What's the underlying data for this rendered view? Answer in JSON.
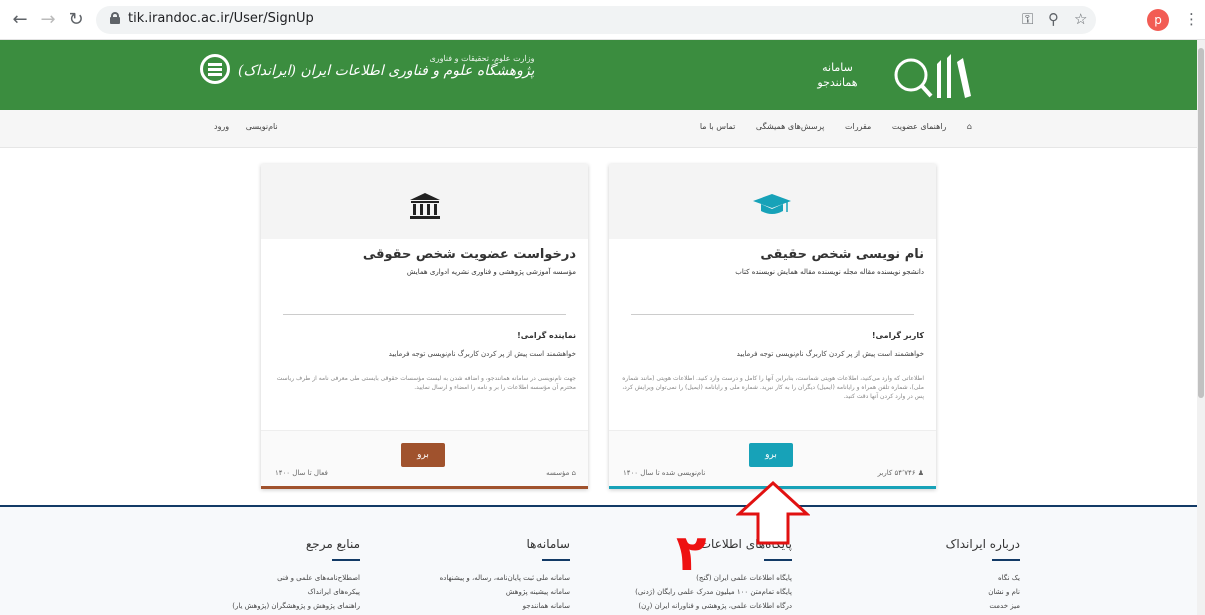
{
  "browser": {
    "url": "tik.irandoc.ac.ir/User/SignUp",
    "profile_initial": "p"
  },
  "header": {
    "brand_right_line1": "سامانه",
    "brand_right_line2": "همانندجو",
    "brand_left_small": "وزارت علوم، تحقیقات و فناوری",
    "brand_left_big": "پژوهشگاه علوم و فناوری اطلاعات ایران (ایرانداک)",
    "bg_color": "#3b8d3f"
  },
  "nav": {
    "items": [
      "راهنمای عضویت",
      "مقررات",
      "پرسش‌های همیشگی",
      "تماس با ما"
    ],
    "signup_label": "نام‌نویسی",
    "login_label": "ورود"
  },
  "cards": {
    "natural": {
      "title": "نام نویسی شخص حقیقی",
      "subtitle": "دانشجو  نویسنده مقاله مجله  نویسنده مقاله همایش  نویسنده کتاب",
      "greeting": "کاربر گرامی!",
      "note": "خواهشمند است پیش از پر کردن کاربرگ نام‌نویسی توجه فرمایید",
      "desc": "اطلاعاتی که وارد می‌کنید، اطلاعات هویتی شماست، بنابراین آنها را کامل و درست وارد کنید. اطلاعات هویتی (مانند شماره ملی)، شماره تلفن همراه و رایانامه (ایمیل) دیگران را به کار نبرید. شماره ملی و رایانامه (ایمیل) را نمی‌توان ویرایش کرد، پس در وارد کردن آنها دقت کنید.",
      "button": "برو",
      "users": "۵۴٬۷۴۶ کاربر",
      "status": "نام‌نویسی شده تا سال ۱۴۰۰",
      "accent": "#17a2b8"
    },
    "legal": {
      "title": "درخواست عضویت شخص حقوقی",
      "subtitle": "مؤسسه آموزشی پژوهشی و فناوری  نشریه ادواری  همایش",
      "greeting": "نماینده گرامی!",
      "note": "خواهشمند است پیش از پر کردن کاربرگ نام‌نویسی توجه فرمایید",
      "desc": "جهت نام‌نویسی در سامانه همانندجو، و اضافه شدن به لیست مؤسسات حقوقی بایستی طی معرفی نامه از طرف ریاست محترم آن مؤسسه اطلاعات را بر و نامه را امضاء و ارسال نمایید.",
      "button": "برو",
      "institutions": "مؤسسه",
      "status": "فعال تا سال ۱۴۰۰",
      "accent": "#a0522d"
    }
  },
  "footer": {
    "cols": [
      {
        "heading": "درباره ایرانداک",
        "items": [
          "یک نگاه",
          "نام و نشان",
          "میز خدمت"
        ]
      },
      {
        "heading": "پایگاه‌های اطلاعات",
        "items": [
          "پایگاه اطلاعات علمی ایران (گنج)",
          "پایگاه تمام‌متن ۱۰۰ میلیون مدرک علمی رایگان (رَدنی)",
          "درگاه اطلاعات علمی، پژوهشی و فناورانه ایران (رِن)"
        ]
      },
      {
        "heading": "سامانه‌ها",
        "items": [
          "سامانه ملی ثبت پایان‌نامه، رساله، و پیشنهاده",
          "سامانه پیشینه پژوهش",
          "سامانه همانندجو"
        ]
      },
      {
        "heading": "منابع مرجع",
        "items": [
          "اصطلاح‌نامه‌های علمی و فنی",
          "پیکره‌های ایرانداک",
          "راهنمای پژوهش و پژوهشگران (پژوهش یار)"
        ]
      }
    ]
  },
  "annotation": {
    "number": "۲",
    "color": "#e11111"
  }
}
